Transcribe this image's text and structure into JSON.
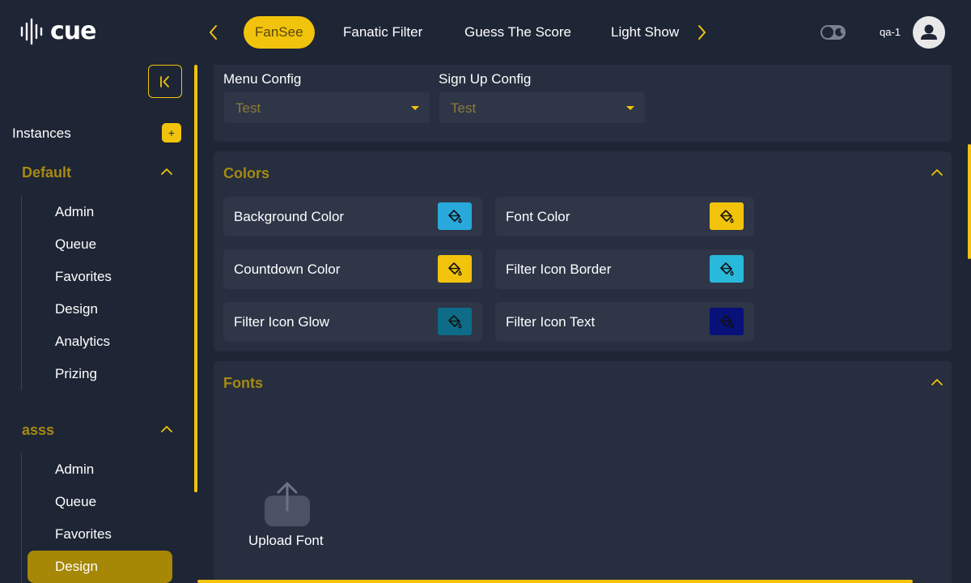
{
  "app": {
    "logo_text": "cue",
    "user_label": "qa-1"
  },
  "nav": {
    "tabs": [
      {
        "label": "FanSee",
        "active": true
      },
      {
        "label": "Fanatic Filter"
      },
      {
        "label": "Guess The Score"
      },
      {
        "label": "Light Show"
      }
    ]
  },
  "sidebar": {
    "instances_label": "Instances",
    "add_label": "+",
    "groups": [
      {
        "title": "Default",
        "items": [
          "Admin",
          "Queue",
          "Favorites",
          "Design",
          "Analytics",
          "Prizing"
        ]
      },
      {
        "title": "asss",
        "items": [
          "Admin",
          "Queue",
          "Favorites",
          "Design"
        ],
        "active_item": "Design"
      }
    ]
  },
  "config": {
    "menu_label": "Menu Config",
    "menu_value": "Test",
    "signup_label": "Sign Up Config",
    "signup_value": "Test"
  },
  "colors_section": {
    "title": "Colors",
    "items": [
      {
        "label": "Background Color",
        "color": "#29a9db"
      },
      {
        "label": "Font Color",
        "color": "#f2c30c"
      },
      {
        "label": "Countdown Color",
        "color": "#f2c30c"
      },
      {
        "label": "Filter Icon Border",
        "color": "#29b9db"
      },
      {
        "label": "Filter Icon Glow",
        "color": "#0e6c88"
      },
      {
        "label": "Filter Icon Text",
        "color": "#08107a"
      }
    ]
  },
  "fonts_section": {
    "title": "Fonts",
    "upload_label": "Upload Font"
  },
  "theme": {
    "accent": "#f2c30c",
    "background": "#1e2535",
    "card": "#262e3f",
    "field": "#2e3648"
  }
}
